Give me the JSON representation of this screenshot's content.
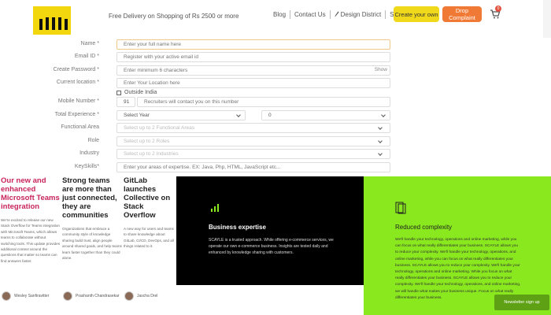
{
  "header": {
    "delivery_text": "Free Delivery on Shopping of Rs 2500 or more",
    "nav": {
      "blog": "Blog",
      "contact": "Contact Us",
      "design_district": "Design District",
      "signup": "Signup"
    },
    "create_button": "Create your own",
    "drop_button": "Drop Complaint",
    "cart_count": "0",
    "colors": {
      "logo": "#f2d60e",
      "create": "#f0d81a",
      "drop": "#f07a35"
    }
  },
  "form": {
    "name": {
      "label": "Name *",
      "placeholder": "Enter your full name here"
    },
    "email": {
      "label": "Email ID *",
      "placeholder": "Register with your active email id"
    },
    "password": {
      "label": "Create Password *",
      "placeholder": "Enter minimum 6 characters",
      "show": "Show"
    },
    "location": {
      "label": "Current location *",
      "placeholder": "Enter Your Location here"
    },
    "outside_india": "Outside India",
    "mobile": {
      "label": "Mobile Number *",
      "code": "91",
      "placeholder": "Recruiters will contact you on this number"
    },
    "experience": {
      "label": "Total Experience *",
      "year": "Select Year",
      "month": "0"
    },
    "functional_area": {
      "label": "Functional Area",
      "placeholder": "Select up to 2 Functional Areas"
    },
    "role": {
      "label": "Role",
      "placeholder": "Select up to 2 Roles"
    },
    "industry": {
      "label": "Industry",
      "placeholder": "Select up to 2 Industries"
    },
    "keyskills": {
      "label": "KeySkills*",
      "placeholder": "Enter your areas of expertise. EX: Java, Php, HTML, JavaScript etc..."
    }
  },
  "articles": [
    {
      "title": "Our new and enhanced Microsoft Teams integration",
      "text": "We're excited to release our new Stack Overflow for Teams integration with Microsoft Teams, which allows teams to collaborate without switching tools. This update provides additional context around the questions that matter so teams can find answers faster.",
      "author": "Wesley Sanfiravitter"
    },
    {
      "title": "Strong teams are more than just connected, they are communities",
      "text": "Organizations that embrace a community style of knowledge sharing build trust, align people around shared goals, and help teams learn faster together than they could alone.",
      "author": "Prashanth Chandrasekar"
    },
    {
      "title": "GitLab launches Collective on Stack Overflow",
      "text": "A new way for users and teams to share knowledge about GitLab, CI/CD, DevOps, and all things related to it.",
      "author": "Jascha Drel"
    }
  ],
  "black_panel": {
    "title": "Business expertise",
    "text": "SCAYLE is a trusted approach. While offering e-commerce services, we operate our own e-commerce business. Insights are tested daily and enhanced by knowledge sharing with customers."
  },
  "green_panel": {
    "title": "Reduced complexity",
    "text": "We'll handle your technology, operations and online marketing, while you can focus on what really differentiates your business. SCAYLE allows you to reduce your complexity. We'll handle your technology, operations, and online marketing, while you can focus on what really differentiates your business. SCAYLE allows you to reduce your complexity. We'll handle your technology, operations and online marketing. While you focus on what really differentiates your business. SCAYLE allows you to reduce your complexity. We'll handle your technology, operations, and online marketing, we will handle what makes your business unique. Focus on what really differentiates your business."
  },
  "newsletter": "Newsletter sign up"
}
